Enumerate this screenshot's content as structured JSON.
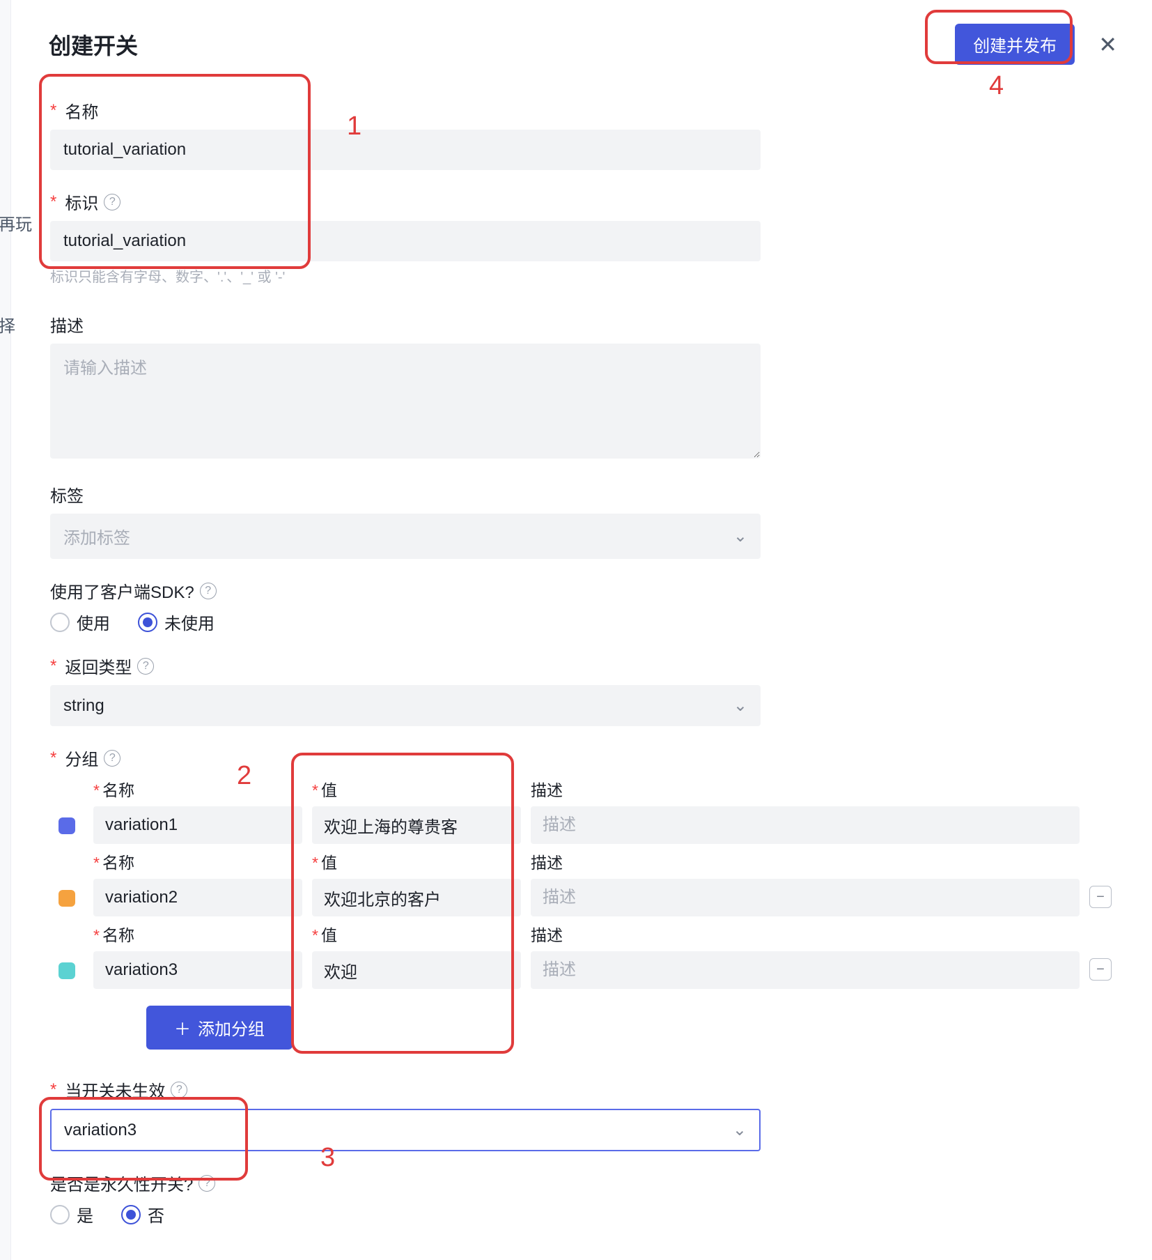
{
  "header": {
    "title": "创建开关",
    "publish_btn": "创建并发布"
  },
  "left_peek": {
    "t1": "再玩",
    "t2": "择"
  },
  "callouts": {
    "n1": "1",
    "n2": "2",
    "n3": "3",
    "n4": "4"
  },
  "fields": {
    "name": {
      "label": "名称",
      "value": "tutorial_variation"
    },
    "key": {
      "label": "标识",
      "value": "tutorial_variation",
      "hint": "标识只能含有字母、数字、'.'、'_' 或 '-'"
    },
    "desc": {
      "label": "描述",
      "placeholder": "请输入描述"
    },
    "tags": {
      "label": "标签",
      "placeholder": "添加标签"
    },
    "sdk": {
      "label": "使用了客户端SDK?",
      "opt_use": "使用",
      "opt_not": "未使用"
    },
    "return_type": {
      "label": "返回类型",
      "value": "string"
    },
    "groups": {
      "label": "分组",
      "col_name": "名称",
      "col_value": "值",
      "col_desc": "描述",
      "desc_placeholder": "描述",
      "rows": [
        {
          "name": "variation1",
          "value": "欢迎上海的尊贵客"
        },
        {
          "name": "variation2",
          "value": "欢迎北京的客户"
        },
        {
          "name": "variation3",
          "value": "欢迎"
        }
      ],
      "add_btn": "添加分组"
    },
    "disabled_value": {
      "label": "当开关未生效",
      "value": "variation3"
    },
    "permanent": {
      "label": "是否是永久性开关?",
      "opt_yes": "是",
      "opt_no": "否"
    }
  }
}
